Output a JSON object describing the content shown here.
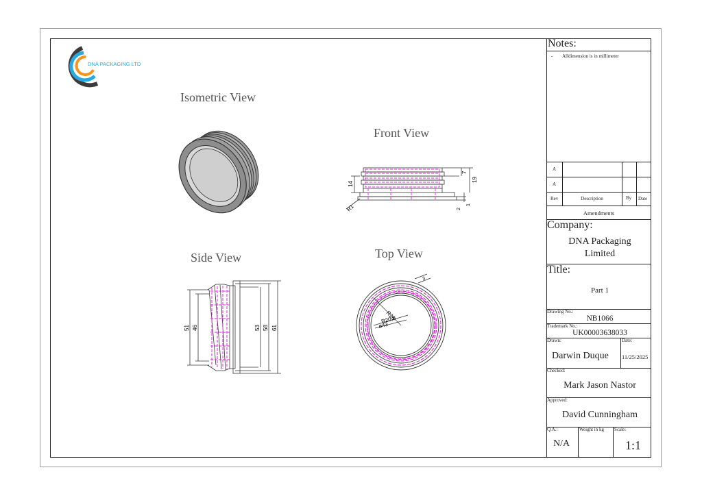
{
  "logo": {
    "text": "DNA PACKAGING LTD",
    "colors": {
      "arc_dark": "#3a3a3a",
      "arc_blue": "#29a9e0",
      "arc_orange": "#f7941d",
      "text": "#29a9e0"
    }
  },
  "views": {
    "isometric": "Isometric View",
    "front": "Front View",
    "side": "Side View",
    "top": "Top View"
  },
  "dimensions": {
    "front": [
      "7",
      "14",
      "19",
      "R1",
      "2",
      "1"
    ],
    "side": [
      "51",
      "46",
      "53",
      "58",
      "61"
    ],
    "top": [
      "R26",
      "R20,5",
      "ø43",
      "3"
    ]
  },
  "title_block": {
    "notes_label": "Notes:",
    "note_1_dash": "-",
    "note_1": "Alldimension is in millimeter",
    "rev_a1": "A",
    "rev_a2": "A",
    "rev_header": {
      "rev": "Rev",
      "description": "Description",
      "by": "By",
      "date": "Date"
    },
    "amendments": "Amendments",
    "company_label": "Company:",
    "company_line1": "DNA Packaging",
    "company_line2": "Limited",
    "title_label": "Title:",
    "title_value": "Part 1",
    "drawing_no_label": "Drawing No.:",
    "drawing_no": "NB1066",
    "trademark_label": "Trademark No.:",
    "trademark_no": "UK00003638033",
    "drawn_label": "Drawn:",
    "drawn_by": "Darwin Duque",
    "date_label": "Date:",
    "date": "11/25/2025",
    "checked_label": "Checked:",
    "checked_by": "Mark Jason Nastor",
    "approved_label": "Approved:",
    "approved_by": "David Cunningham",
    "qa_label": "Q.A.:",
    "qa_value": "N/A",
    "weight_label": "Weight in kg",
    "scale_label": "Scale:",
    "scale_value": "1:1"
  },
  "colors": {
    "hidden_line": "#e024e0",
    "part_fill": "#a8a8a8",
    "line": "#333333"
  }
}
